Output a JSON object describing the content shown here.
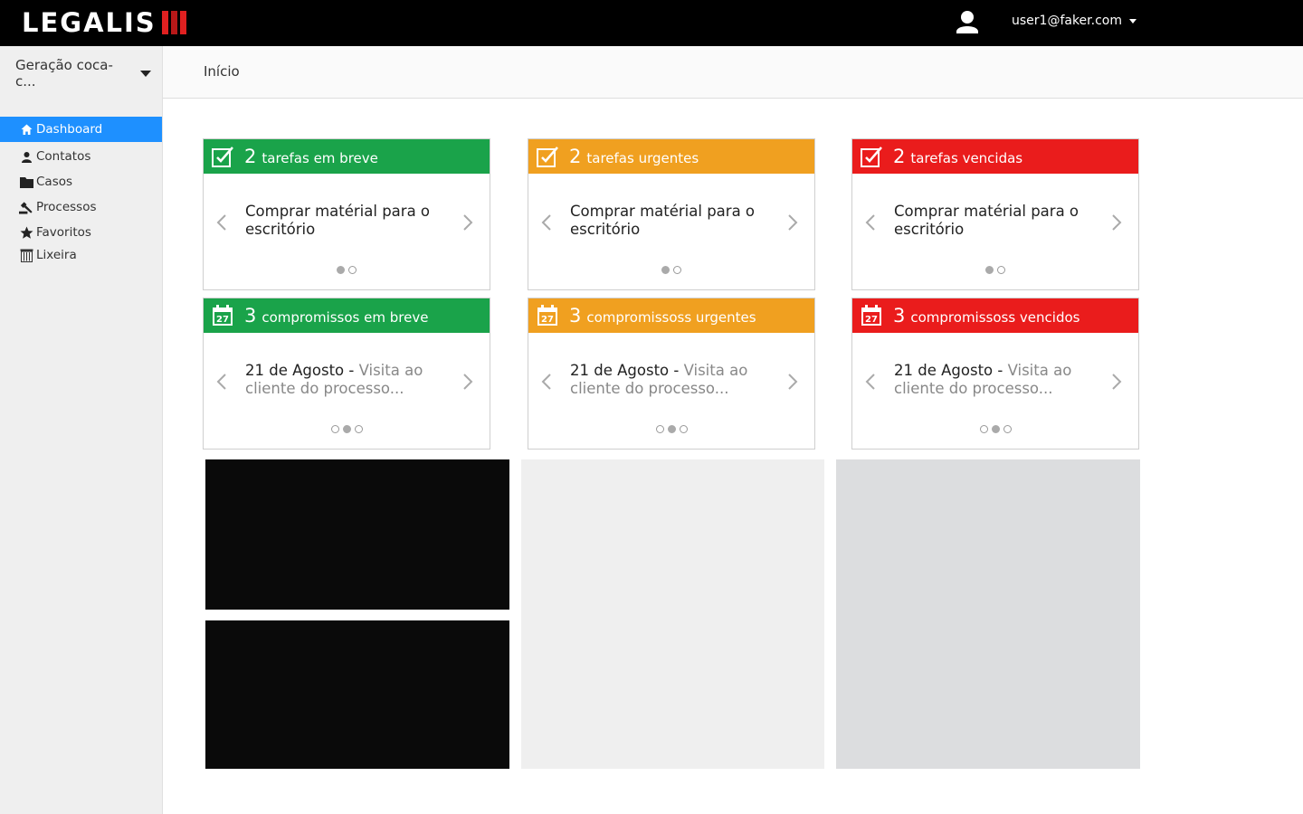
{
  "header": {
    "logo_text": "LEGALIS",
    "user_email": "user1@faker.com",
    "user_icon": "user-icon"
  },
  "sidebar": {
    "org_select": "Geração coca-c...",
    "items": [
      {
        "label": "Dashboard",
        "icon": "home-icon",
        "active": true
      },
      {
        "label": "Contatos",
        "icon": "person-icon"
      },
      {
        "label": "Casos",
        "icon": "folder-icon"
      },
      {
        "label": "Processos",
        "icon": "gavel-icon"
      },
      {
        "label": "Favoritos",
        "icon": "star-icon"
      },
      {
        "label": "Lixeira",
        "icon": "trash-icon"
      }
    ]
  },
  "breadcrumb": {
    "current": "Início"
  },
  "colors": {
    "green": "#1aa34a",
    "orange": "#f0a020",
    "red": "#ea1c1c",
    "active_nav": "#1e90ff"
  },
  "cards": [
    {
      "count": "2",
      "label": "tarefas em breve",
      "icon": "task-icon",
      "text": "Comprar matérial para o escritório",
      "muted": "",
      "dots": 2,
      "active_dot": 0
    },
    {
      "count": "2",
      "label": "tarefas urgentes",
      "icon": "task-icon",
      "text": "Comprar matérial para o escritório",
      "muted": "",
      "dots": 2,
      "active_dot": 0
    },
    {
      "count": "2",
      "label": "tarefas vencidas",
      "icon": "task-icon",
      "text": "Comprar matérial para o escritório",
      "muted": "",
      "dots": 2,
      "active_dot": 0
    },
    {
      "count": "3",
      "label": "compromissos em breve",
      "icon": "calendar-icon",
      "text": "21 de Agosto - ",
      "muted": "Visita ao cliente do processo...",
      "dots": 3,
      "active_dot": 1,
      "calendar_day": "27"
    },
    {
      "count": "3",
      "label": "compromissoss urgentes",
      "icon": "calendar-icon",
      "text": "21 de Agosto - ",
      "muted": "Visita ao cliente do processo...",
      "dots": 3,
      "active_dot": 1,
      "calendar_day": "27"
    },
    {
      "count": "3",
      "label": "compromissoss vencidos",
      "icon": "calendar-icon",
      "text": "21 de Agosto - ",
      "muted": "Visita ao cliente do processo...",
      "dots": 3,
      "active_dot": 1,
      "calendar_day": "27"
    }
  ]
}
